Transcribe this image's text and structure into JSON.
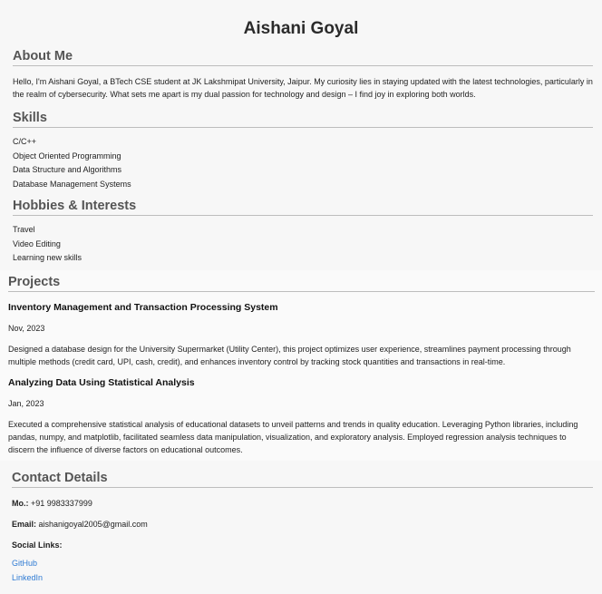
{
  "name": "Aishani Goyal",
  "about": {
    "heading": "About Me",
    "text": "Hello, I'm Aishani Goyal, a BTech CSE student at JK Lakshmipat University, Jaipur. My curiosity lies in staying updated with the latest technologies, particularly in the realm of cybersecurity. What sets me apart is my dual passion for technology and design – I find joy in exploring both worlds."
  },
  "skills": {
    "heading": "Skills",
    "items": [
      "C/C++",
      "Object Oriented Programming",
      "Data Structure and Algorithms",
      "Database Management Systems"
    ]
  },
  "hobbies": {
    "heading": "Hobbies & Interests",
    "items": [
      "Travel",
      "Video Editing",
      "Learning new skills"
    ]
  },
  "projects": {
    "heading": "Projects",
    "items": [
      {
        "title": "Inventory Management and Transaction Processing System",
        "date": "Nov, 2023",
        "description": "Designed a database design for the University Supermarket (Utility Center), this project optimizes user experience, streamlines payment processing through multiple methods (credit card, UPI, cash, credit), and enhances inventory control by tracking stock quantities and transactions in real-time."
      },
      {
        "title": "Analyzing Data Using Statistical Analysis",
        "date": "Jan, 2023",
        "description": "Executed a comprehensive statistical analysis of educational datasets to unveil patterns and trends in quality education. Leveraging Python libraries, including pandas, numpy, and matplotlib, facilitated seamless data manipulation, visualization, and exploratory analysis. Employed regression analysis techniques to discern the influence of diverse factors on educational outcomes."
      }
    ]
  },
  "contact": {
    "heading": "Contact Details",
    "mobile_label": "Mo.:",
    "mobile_value": "+91 9983337999",
    "email_label": "Email:",
    "email_value": "aishanigoyal2005@gmail.com",
    "social_label": "Social Links:",
    "links": [
      "GitHub",
      "LinkedIn"
    ]
  },
  "colors": {
    "heading": "#555555",
    "link": "#2f7bd3",
    "background": "#f7f7f7"
  }
}
